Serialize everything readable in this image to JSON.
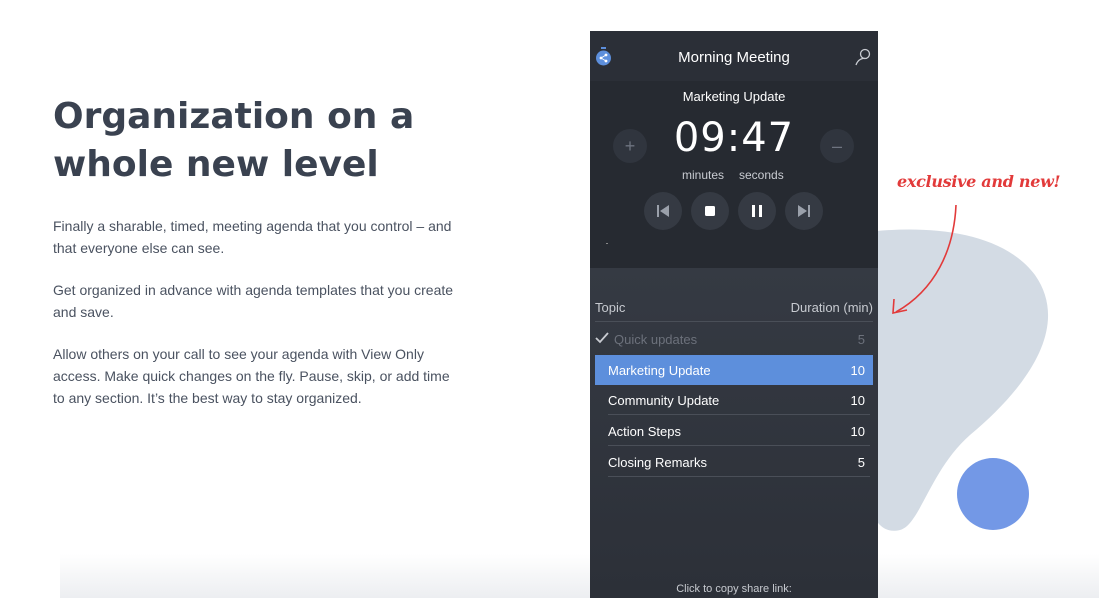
{
  "headline": {
    "line1": "Organization on a",
    "line2": "whole new level"
  },
  "paragraphs": [
    "Finally a sharable, timed, meeting agenda that you control – and that everyone else can see.",
    "Get organized in advance with agenda templates that you create and save.",
    "Allow others on your call to see your agenda with View Only access. Make quick changes on the fly. Pause, skip, or add time to any section. It’s the best way to stay organized."
  ],
  "annotation": "exclusive and new!",
  "app": {
    "title": "Morning Meeting",
    "current_topic": "Marketing Update",
    "timer": "09:47",
    "units": {
      "minutes": "minutes",
      "seconds": "seconds"
    },
    "plus": "+",
    "minus": "–",
    "list_header": {
      "topic": "Topic",
      "duration": "Duration (min)"
    },
    "items": [
      {
        "name": "Quick updates",
        "duration": "5",
        "state": "done"
      },
      {
        "name": "Marketing Update",
        "duration": "10",
        "state": "active"
      },
      {
        "name": "Community Update",
        "duration": "10",
        "state": "pending"
      },
      {
        "name": "Action Steps",
        "duration": "10",
        "state": "pending"
      },
      {
        "name": "Closing Remarks",
        "duration": "5",
        "state": "pending"
      }
    ],
    "share_label": "Click to copy share link:"
  },
  "colors": {
    "accent": "#5d8fdc",
    "annotation": "#e23a3a",
    "blob": "#d3dbe4",
    "dot": "#7398e6",
    "phone_bg": "#2f343d"
  },
  "icons": [
    "stopwatch-share-icon",
    "user-icon",
    "previous-icon",
    "stop-icon",
    "pause-icon",
    "next-icon",
    "check-icon",
    "arrow-icon"
  ]
}
